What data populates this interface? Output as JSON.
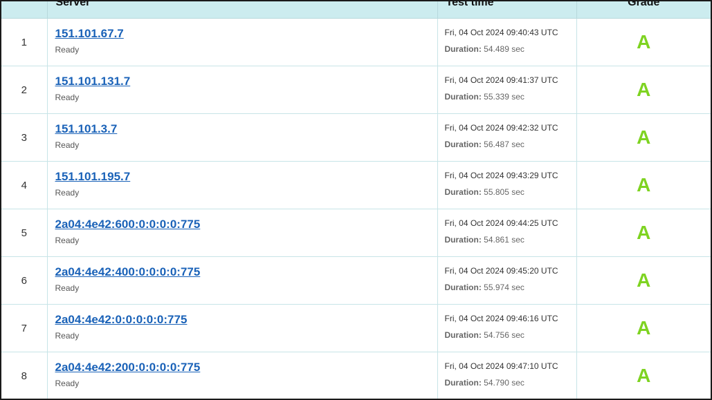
{
  "table": {
    "headers": {
      "server": "Server",
      "test_time": "Test time",
      "grade": "Grade"
    },
    "rows": [
      {
        "num": "1",
        "server": "151.101.67.7",
        "status": "Ready",
        "date": "Fri, 04 Oct 2024 09:40:43 UTC",
        "duration_label": "Duration:",
        "duration_value": "54.489 sec",
        "grade": "A"
      },
      {
        "num": "2",
        "server": "151.101.131.7",
        "status": "Ready",
        "date": "Fri, 04 Oct 2024 09:41:37 UTC",
        "duration_label": "Duration:",
        "duration_value": "55.339 sec",
        "grade": "A"
      },
      {
        "num": "3",
        "server": "151.101.3.7",
        "status": "Ready",
        "date": "Fri, 04 Oct 2024 09:42:32 UTC",
        "duration_label": "Duration:",
        "duration_value": "56.487 sec",
        "grade": "A"
      },
      {
        "num": "4",
        "server": "151.101.195.7",
        "status": "Ready",
        "date": "Fri, 04 Oct 2024 09:43:29 UTC",
        "duration_label": "Duration:",
        "duration_value": "55.805 sec",
        "grade": "A"
      },
      {
        "num": "5",
        "server": "2a04:4e42:600:0:0:0:0:775",
        "status": "Ready",
        "date": "Fri, 04 Oct 2024 09:44:25 UTC",
        "duration_label": "Duration:",
        "duration_value": "54.861 sec",
        "grade": "A"
      },
      {
        "num": "6",
        "server": "2a04:4e42:400:0:0:0:0:775",
        "status": "Ready",
        "date": "Fri, 04 Oct 2024 09:45:20 UTC",
        "duration_label": "Duration:",
        "duration_value": "55.974 sec",
        "grade": "A"
      },
      {
        "num": "7",
        "server": "2a04:4e42:0:0:0:0:0:775",
        "status": "Ready",
        "date": "Fri, 04 Oct 2024 09:46:16 UTC",
        "duration_label": "Duration:",
        "duration_value": "54.756 sec",
        "grade": "A"
      },
      {
        "num": "8",
        "server": "2a04:4e42:200:0:0:0:0:775",
        "status": "Ready",
        "date": "Fri, 04 Oct 2024 09:47:10 UTC",
        "duration_label": "Duration:",
        "duration_value": "54.790 sec",
        "grade": "A"
      }
    ]
  },
  "colors": {
    "header_bg": "#ccecef",
    "link": "#1a62b8",
    "grade_a": "#7ed321",
    "row_border": "#c7e4e7"
  }
}
